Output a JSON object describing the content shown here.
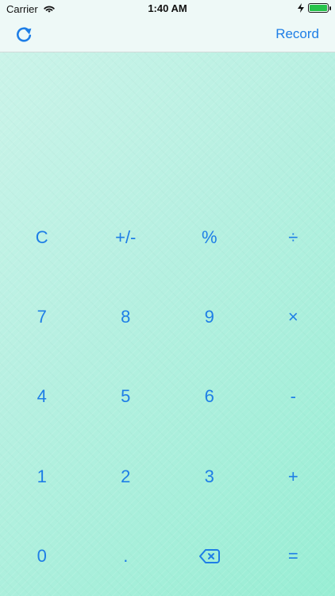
{
  "status_bar": {
    "carrier": "Carrier",
    "time": "1:40 AM"
  },
  "nav": {
    "record_label": "Record",
    "accent_color": "#1e7ee6",
    "refresh_icon": "refresh-icon"
  },
  "keypad": {
    "rows": [
      [
        "C",
        "+/-",
        "%",
        "÷"
      ],
      [
        "7",
        "8",
        "9",
        "×"
      ],
      [
        "4",
        "5",
        "6",
        "-"
      ],
      [
        "1",
        "2",
        "3",
        "+"
      ],
      [
        "0",
        ".",
        "⌫",
        "="
      ]
    ]
  },
  "theme": {
    "background_gradient": [
      "#cdf4ea",
      "#98eed4"
    ],
    "text_color": "#1e7ee6"
  }
}
